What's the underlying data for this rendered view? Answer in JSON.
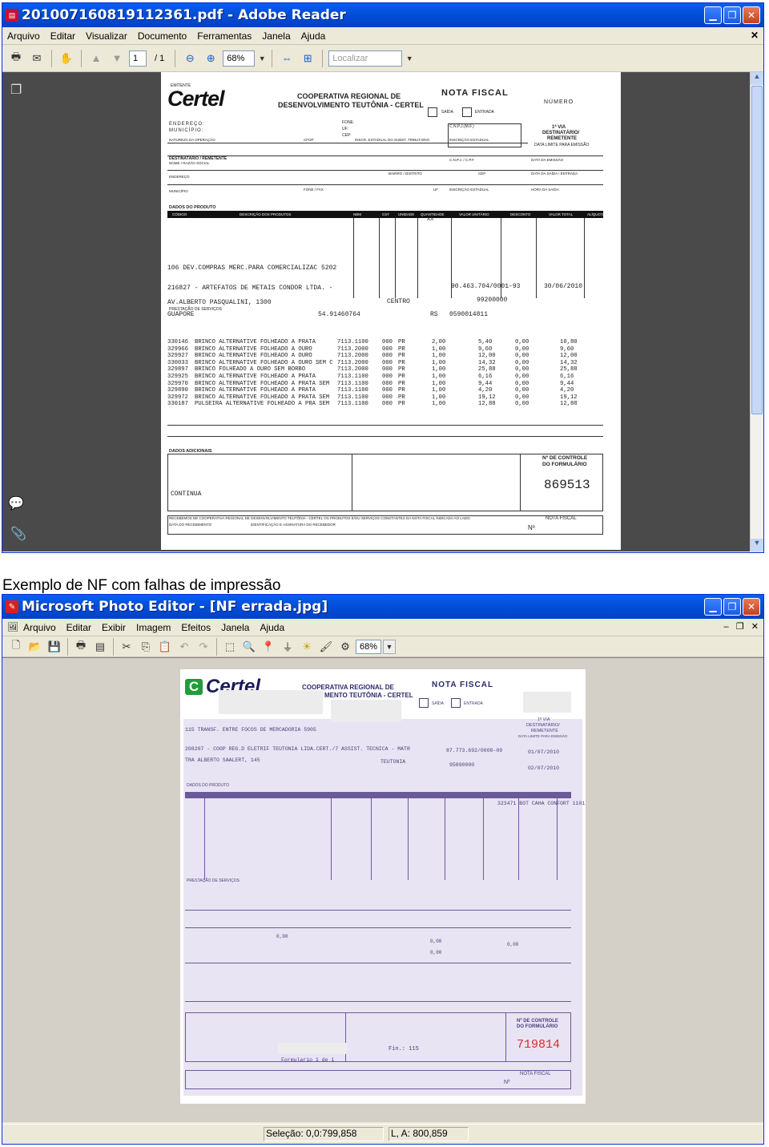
{
  "reader": {
    "title": "201007160819112361.pdf - Adobe Reader",
    "menu": [
      "Arquivo",
      "Editar",
      "Visualizar",
      "Documento",
      "Ferramentas",
      "Janela",
      "Ajuda"
    ],
    "page_current": "1",
    "page_total": "/ 1",
    "zoom": "68%",
    "search_placeholder": "Localizar"
  },
  "caption": "Exemplo de NF com falhas de impressão",
  "editor": {
    "title": "Microsoft Photo Editor - [NF errada.jpg]",
    "menu": [
      "Arquivo",
      "Editar",
      "Exibir",
      "Imagem",
      "Efeitos",
      "Janela",
      "Ajuda"
    ],
    "zoom": "68%",
    "status_selection": "Seleção: 0,0:799,858",
    "status_size": "L, A: 800,859"
  },
  "invoice1": {
    "emitente": "EMITENTE",
    "brand": "Certel",
    "coop1": "COOPERATIVA REGIONAL DE",
    "coop2": "DESENVOLVIMENTO TEUTÔNIA - CERTEL",
    "nota": "NOTA FISCAL",
    "numero": "NÚMERO",
    "saida": "SAÍDA",
    "entrada": "ENTRADA",
    "endereco": "ENDEREÇO:",
    "municipio": "MUNICÍPIO:",
    "fone": "FONE:",
    "uf": "UF:",
    "cep": "CEP:",
    "via": "1ª VIA",
    "dest": "DESTINATÁRIO/",
    "rem": "REMETENTE",
    "data_limite": "DATA LIMITE PARA EMISSÃO",
    "natureza": "NATUREZA DA OPERAÇÃO",
    "cfop": "CFOP",
    "insc_subst": "INSCR. ESTADUAL DO SUBST. TRIBUTÁRIO",
    "insc_est": "INSCRIÇÃO ESTADUAL",
    "cnpj": "C.N.P.J.(M.F.)",
    "destinatario": "DESTINATÁRIO / REMETENTE",
    "nome": "NOME / RAZÃO SOCIAL",
    "cnpj_cpf": "C.N.P.J. / C.P.F.",
    "data_emissao": "DATA DA EMISSÃO",
    "endereco2": "ENDEREÇO",
    "bairro": "BAIRRO / DISTRITO",
    "cep2": "CEP",
    "data_saida": "DATA DA SAÍDA / ENTRADA",
    "municipio2": "MUNICÍPIO",
    "fone_fax": "FONE / FAX",
    "uf2": "UF",
    "insc_est2": "INSCRIÇÃO ESTADUAL",
    "hora": "HORA DA SAÍDA",
    "dados_produto": "DADOS DO PRODUTO",
    "col_headers": [
      "CÓDIGO",
      "DESCRIÇÃO DOS PRODUTOS",
      "NBM",
      "CST",
      "UNIDADE",
      "QUANTIDADE",
      "VALOR UNITÁRIO",
      "DESCONTO",
      "VALOR TOTAL",
      "ALÍQUOTA"
    ],
    "xx": "XX",
    "line_nature": "106 DEV.COMPRAS MERC.PARA COMERCIALIZAC   5202",
    "line_dest": "216827 - ARTEFATOS DE METAIS CONDOR LTDA. -",
    "line_cnpj": "90.463.704/0001-93",
    "line_date": "30/06/2010",
    "line_addr": "AV.ALBERTO PASQUALINI, 1300",
    "line_bairro": "CENTRO",
    "line_cep": "99200000",
    "line_ie1": "GUAPORE",
    "line_ie2": "54.914607​64",
    "line_rs": "RS",
    "line_ie3": "0590014811",
    "items": [
      {
        "code": "330146",
        "desc": "BRINCO ALTERNATIVE FOLHEADO A PRATA",
        "ncm": "7113.1100",
        "cst": "000",
        "un": "PR",
        "qtd": "2,00",
        "vu": "5,40",
        "desc2": "0,00",
        "vt": "10,80"
      },
      {
        "code": "329966",
        "desc": "BRINCO ALTERNATIVE FOLHEADO A OURO",
        "ncm": "7113.2000",
        "cst": "000",
        "un": "PR",
        "qtd": "1,00",
        "vu": "9,60",
        "desc2": "0,00",
        "vt": "9,60"
      },
      {
        "code": "329927",
        "desc": "BRINCO ALTERNATIVE FOLHEADO A OURO",
        "ncm": "7113.2000",
        "cst": "000",
        "un": "PR",
        "qtd": "1,00",
        "vu": "12,00",
        "desc2": "0,00",
        "vt": "12,00"
      },
      {
        "code": "330033",
        "desc": "BRINCO ALTERNATIVE FOLHEADO A OURO SEM C",
        "ncm": "7113.2000",
        "cst": "000",
        "un": "PR",
        "qtd": "1,00",
        "vu": "14,32",
        "desc2": "0,00",
        "vt": "14,32"
      },
      {
        "code": "329897",
        "desc": "BRINCO FOLHEADO A OURO SEM BORBO",
        "ncm": "7113.2000",
        "cst": "000",
        "un": "PR",
        "qtd": "1,00",
        "vu": "25,88",
        "desc2": "0,00",
        "vt": "25,88"
      },
      {
        "code": "329925",
        "desc": "BRINCO ALTERNATIVE FOLHEADO A PRATA",
        "ncm": "7113.1100",
        "cst": "000",
        "un": "PR",
        "qtd": "1,00",
        "vu": "6,16",
        "desc2": "0,00",
        "vt": "6,16"
      },
      {
        "code": "329970",
        "desc": "BRINCO ALTERNATIVE FOLHEADO A PRATA SEM",
        "ncm": "7113.1100",
        "cst": "000",
        "un": "PR",
        "qtd": "1,00",
        "vu": "9,44",
        "desc2": "0,00",
        "vt": "9,44"
      },
      {
        "code": "329890",
        "desc": "BRINCO ALTERNATIVE FOLHEADO A PRATA",
        "ncm": "7113.1100",
        "cst": "000",
        "un": "PR",
        "qtd": "1,00",
        "vu": "4,20",
        "desc2": "0,00",
        "vt": "4,20"
      },
      {
        "code": "329972",
        "desc": "BRINCO ALTERNATIVE FOLHEADO A PRATA SEM",
        "ncm": "7113.1100",
        "cst": "000",
        "un": "PR",
        "qtd": "1,00",
        "vu": "19,12",
        "desc2": "0,00",
        "vt": "19,12"
      },
      {
        "code": "330187",
        "desc": "PULSEIRA ALTERNATIVE FOLHEADO A PRA SEM",
        "ncm": "7113.1100",
        "cst": "000",
        "un": "PR",
        "qtd": "1,00",
        "vu": "12,88",
        "desc2": "0,00",
        "vt": "12,88"
      }
    ],
    "prestacao": "PRESTAÇÃO DE SERVIÇOS",
    "dados_adicionais": "DADOS ADICIONAIS",
    "continua": "CONTINUA",
    "controle1": "Nº DE CONTROLE",
    "controle2": "DO FORMULÁRIO",
    "control_number": "869513",
    "recebemos": "RECEBEMOS DE COOPERATIVA REGIONAL DE DESENVOLVIMENTO TEUTÔNIA - CERTEL OS PRODUTOS E/OU SERVIÇOS CONSTANTES DA NOTA FISCAL INDICADA AO LADO.",
    "data_receb": "DATA DO RECEBIMENTO",
    "ident": "IDENTIFICAÇÃO E ASSINATURA DO RECEBEDOR",
    "nf_foot": "NOTA FISCAL",
    "nro": "Nº"
  },
  "invoice2": {
    "brand": "Certel",
    "coop1": "COOPERATIVA REGIONAL DE",
    "coop2": "MENTO TEUTÔNIA - CERTEL",
    "nota": "NOTA FISCAL",
    "saida": "SAÍDA",
    "entrada": "ENTRADA",
    "via": "1ª VIA",
    "dest": "DESTINATÁRIO/",
    "rem": "REMETENTE",
    "data_limite": "DATA LIMITE PARA EMISSÃO",
    "line1": "115 TRANSF. ENTRE FOCOS DE MERCADORIA   5905",
    "line2": "208207 - COOP REG.D ELETRIF TEUTONIA LIDA.CERT./7 ASSIST. TECNICA - MATR",
    "line3": "TRA ALBERTO SAALERT, 145",
    "line_cnpj": "87.773.692/0008-09",
    "line_date1": "01/07/2010",
    "line_bairro": "TEUTONIA",
    "line_cep": "95890000",
    "line_date2": "02/07/2010",
    "item": "323471  BOT CAHA CONFORT 1101",
    "dados_produto": "DADOS DO PRODUTO",
    "prestacao": "PRESTAÇÃO DE SERVIÇOS",
    "zero1": "0,00",
    "zero2": "0,00",
    "zero3": "0,00",
    "zero4": "0,00",
    "controle1": "Nº DE CONTROLE",
    "controle2": "DO FORMULÁRIO",
    "control_number": "719814",
    "fin": "Fin.: 115",
    "formulario": "Formulario 1 de 1",
    "nf_foot": "NOTA FISCAL",
    "nro": "Nº"
  }
}
